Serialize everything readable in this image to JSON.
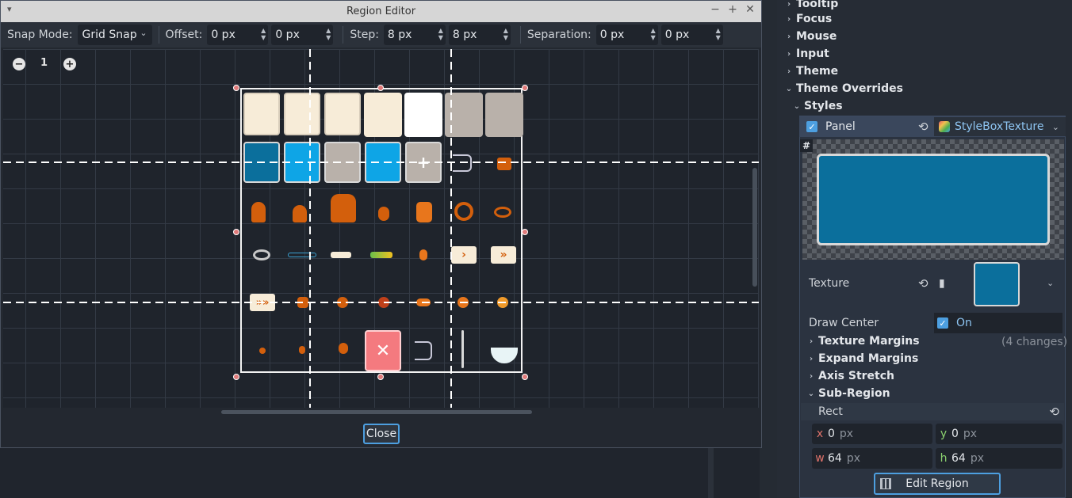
{
  "dialog": {
    "title": "Region Editor",
    "minimize_glyph": "−",
    "maximize_glyph": "+",
    "close_glyph": "✕",
    "close_label": "Close",
    "toolbar": {
      "snap_mode_label": "Snap Mode:",
      "snap_mode_value": "Grid Snap",
      "offset_label": "Offset:",
      "offset_x": "0 px",
      "offset_y": "0 px",
      "step_label": "Step:",
      "step_x": "8 px",
      "step_y": "8 px",
      "separation_label": "Separation:",
      "separation_x": "0 px",
      "separation_y": "0 px"
    },
    "zoom": {
      "out": "−",
      "reset": "1",
      "in": "+"
    }
  },
  "inspector": {
    "sections": [
      {
        "label": "Tooltip"
      },
      {
        "label": "Focus"
      },
      {
        "label": "Mouse"
      },
      {
        "label": "Input"
      },
      {
        "label": "Theme"
      },
      {
        "label": "Theme Overrides"
      }
    ],
    "styles_label": "Styles",
    "panel_label": "Panel",
    "stylebox_type": "StyleBoxTexture",
    "texture_label": "Texture",
    "draw_center_label": "Draw Center",
    "draw_center_value": "On",
    "texture_margins_label": "Texture Margins",
    "texture_margins_changes": "(4 changes)",
    "expand_margins_label": "Expand Margins",
    "axis_stretch_label": "Axis Stretch",
    "sub_region_label": "Sub-Region",
    "rect_label": "Rect",
    "rect": {
      "x": "0",
      "y": "0",
      "w": "64",
      "h": "64",
      "unit": "px"
    },
    "edit_region_label": "Edit Region"
  },
  "colors": {
    "accent": "#4d9fe0",
    "tile_cream": "#f7ecd8",
    "tile_blue_dark": "#0b6f9c",
    "tile_blue_light": "#0ea5e6",
    "tile_grey": "#b9b1aa",
    "tile_red": "#f47a7f",
    "sprite_orange": "#d35f0c"
  }
}
